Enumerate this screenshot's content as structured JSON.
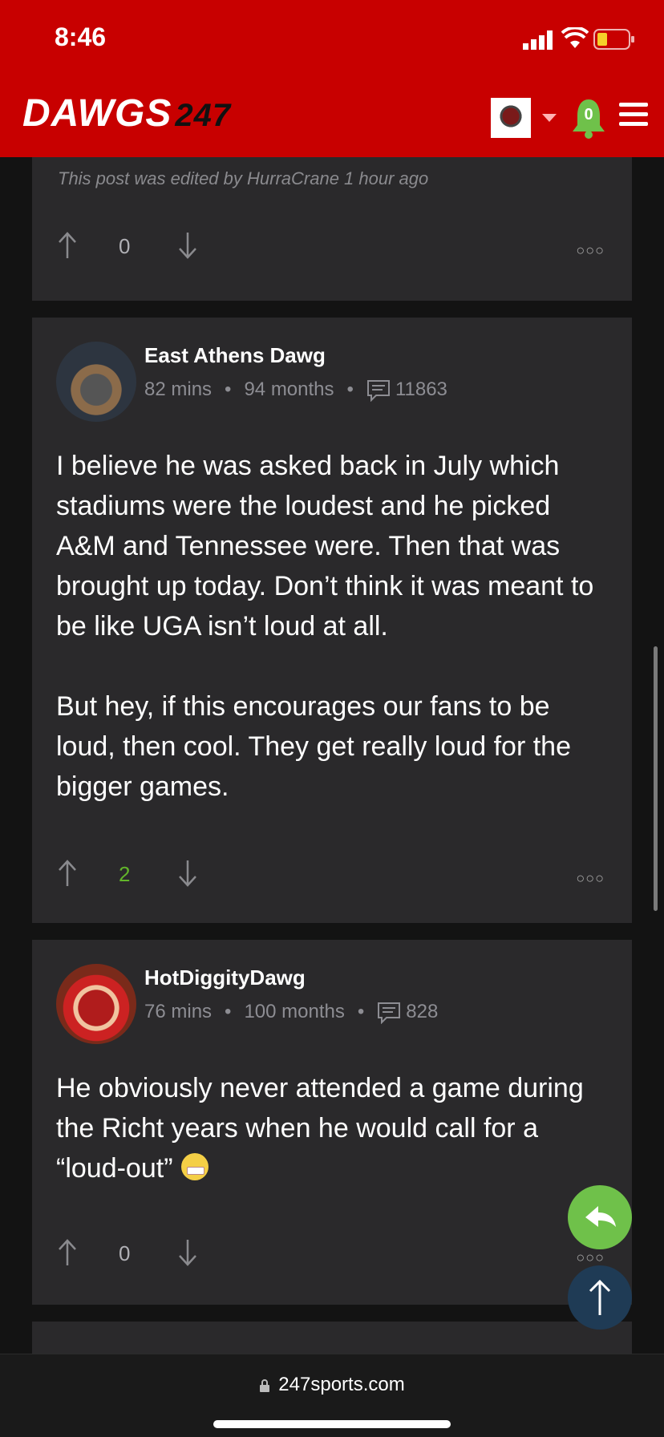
{
  "status": {
    "time": "8:46"
  },
  "header": {
    "logo_text": "DAWGS",
    "logo_num": "247",
    "notification_count": "0"
  },
  "top_post": {
    "edited_note": "This post was edited by HurraCrane 1 hour ago",
    "vote_count": "0"
  },
  "posts": [
    {
      "username": "East Athens Dawg",
      "time_ago": "82 mins",
      "tenure": "94 months",
      "post_count": "11863",
      "paragraph1": "I believe he was asked back in July which stadiums were the loudest and he picked A&M and Tennessee were. Then that was brought up today. Don’t think it was meant to be like UGA isn’t loud at all.",
      "paragraph2": "But hey, if this encourages our fans to be loud, then cool. They get really loud for the bigger games.",
      "vote_count": "2"
    },
    {
      "username": "HotDiggityDawg",
      "time_ago": "76 mins",
      "tenure": "100 months",
      "post_count": "828",
      "text": "He obviously never attended a game during the Richt years when he would call for a “loud-out”",
      "vote_count": "0"
    }
  ],
  "browser": {
    "url": "247sports.com"
  },
  "colors": {
    "brand_red": "#c80000",
    "positive_green": "#62b52a",
    "card_bg": "#2a292b"
  }
}
